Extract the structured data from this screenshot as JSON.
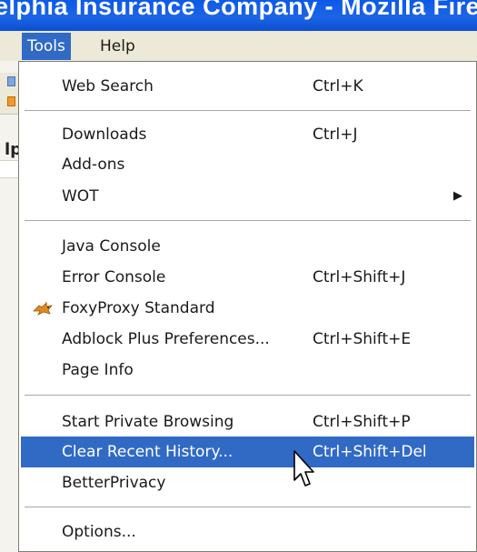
{
  "window": {
    "title_fragment": "elphia Insurance Company - Mozilla Firefo"
  },
  "menubar": {
    "tools_label": "Tools",
    "help_label": "Help"
  },
  "background": {
    "text_fragment": "lp"
  },
  "tools_menu": {
    "web_search": {
      "label": "Web Search",
      "shortcut": "Ctrl+K"
    },
    "downloads": {
      "label": "Downloads",
      "shortcut": "Ctrl+J"
    },
    "addons": {
      "label": "Add-ons"
    },
    "wot": {
      "label": "WOT",
      "submenu_arrow": "▶"
    },
    "java_console": {
      "label": "Java Console"
    },
    "error_console": {
      "label": "Error Console",
      "shortcut": "Ctrl+Shift+J"
    },
    "foxyproxy": {
      "label": "FoxyProxy Standard",
      "icon": "foxyproxy-fox-icon"
    },
    "adblock": {
      "label": "Adblock Plus Preferences...",
      "shortcut": "Ctrl+Shift+E"
    },
    "page_info": {
      "label": "Page Info"
    },
    "private_browsing": {
      "label": "Start Private Browsing",
      "shortcut": "Ctrl+Shift+P"
    },
    "clear_history": {
      "label": "Clear Recent History...",
      "shortcut": "Ctrl+Shift+Del",
      "state": "highlighted"
    },
    "better_privacy": {
      "label": "BetterPrivacy"
    },
    "options": {
      "label": "Options..."
    }
  },
  "colors": {
    "highlight": "#316ac5",
    "menubar_bg": "#ece9d8",
    "titlebar": "#0b5ae8"
  }
}
